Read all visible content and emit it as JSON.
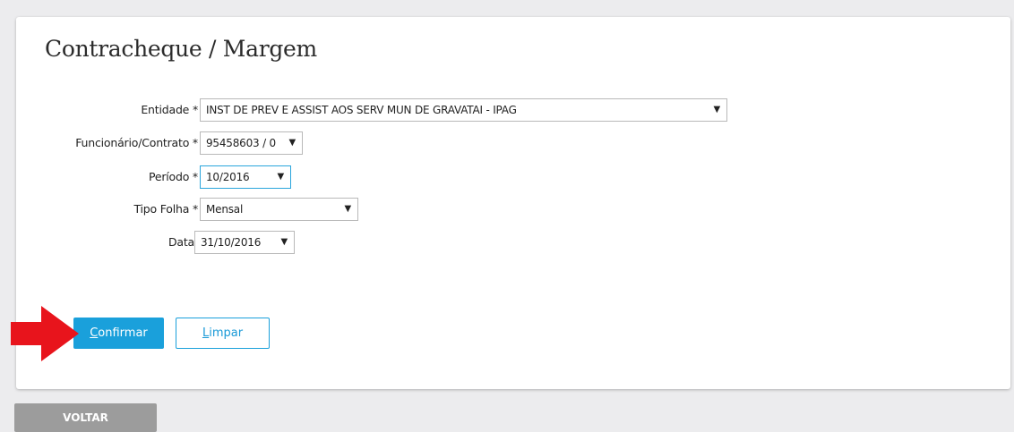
{
  "page": {
    "title": "Contracheque / Margem"
  },
  "form": {
    "entidade": {
      "label": "Entidade *",
      "value": "INST DE PREV E ASSIST AOS SERV MUN DE GRAVATAI - IPAG"
    },
    "funcionario": {
      "label": "Funcionário/Contrato *",
      "value": "95458603 / 0"
    },
    "periodo": {
      "label": "Período *",
      "value": "10/2016"
    },
    "tipo_folha": {
      "label": "Tipo Folha *",
      "value": "Mensal"
    },
    "data": {
      "label": "Data:",
      "value": "31/10/2016"
    }
  },
  "actions": {
    "confirm_first": "C",
    "confirm_rest": "onfirmar",
    "clear_first": "L",
    "clear_rest": "impar",
    "back_label": "VOLTAR"
  },
  "icons": {
    "caret": "▼",
    "pointer": "red-arrow-icon"
  },
  "colors": {
    "primary": "#1aa0db",
    "arrow": "#e8141c",
    "back": "#9c9c9c"
  }
}
